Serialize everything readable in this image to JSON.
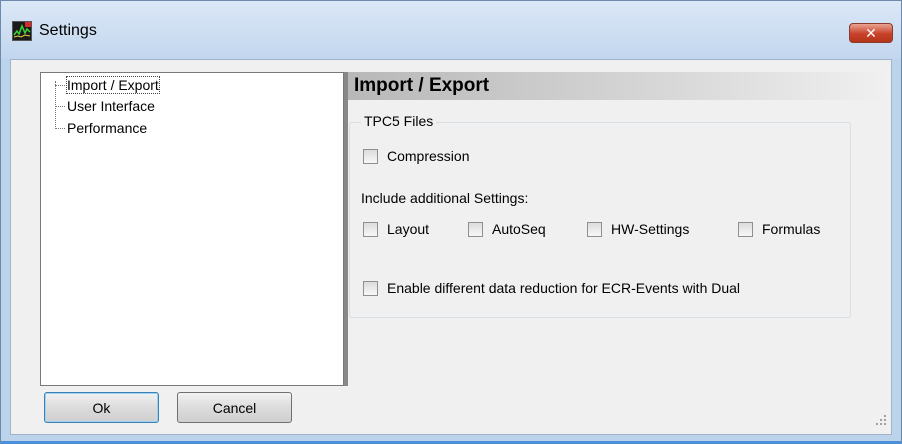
{
  "window": {
    "title": "Settings",
    "close_label": "✕"
  },
  "tree": {
    "items": [
      {
        "label": "Import / Export",
        "selected": true
      },
      {
        "label": "User Interface",
        "selected": false
      },
      {
        "label": "Performance",
        "selected": false
      }
    ]
  },
  "panel": {
    "header": "Import / Export",
    "group_title": "TPC5 Files",
    "compression_label": "Compression",
    "include_label": "Include additional Settings:",
    "options": [
      {
        "label": "Layout",
        "checked": false
      },
      {
        "label": "AutoSeq",
        "checked": false
      },
      {
        "label": "HW-Settings",
        "checked": false
      },
      {
        "label": "Formulas",
        "checked": false
      }
    ],
    "dual_label": "Enable different data reduction for ECR-Events with Dual"
  },
  "buttons": {
    "ok": "Ok",
    "cancel": "Cancel"
  },
  "colors": {
    "frame": "#bcd3ec",
    "close": "#c8412a",
    "client": "#f0f0f0"
  }
}
